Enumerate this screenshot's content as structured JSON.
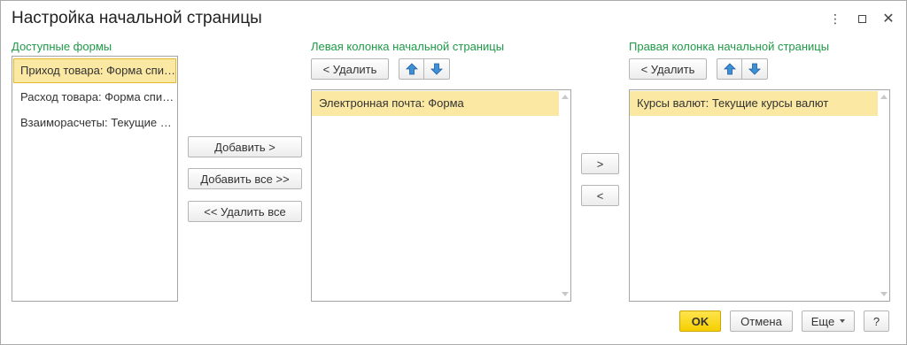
{
  "window": {
    "title": "Настройка начальной страницы",
    "more_glyph": "⋮",
    "close_glyph": "✕"
  },
  "available": {
    "label": "Доступные формы",
    "items": [
      "Приход товара: Форма списка",
      "Расход товара: Форма списка",
      "Взаиморасчеты: Текущие взаиморасчеты"
    ],
    "selected_index": 0
  },
  "middle_buttons": {
    "add": "Добавить >",
    "add_all": "Добавить все >>",
    "remove_all": "<< Удалить все"
  },
  "left_column": {
    "label": "Левая колонка начальной страницы",
    "remove_button": "< Удалить",
    "items": [
      "Электронная почта: Форма"
    ]
  },
  "move_buttons": {
    "to_right": ">",
    "to_left": "<"
  },
  "right_column": {
    "label": "Правая колонка начальной страницы",
    "remove_button": "< Удалить",
    "items": [
      "Курсы валют: Текущие курсы валют"
    ]
  },
  "footer": {
    "ok": "OK",
    "cancel": "Отмена",
    "more": "Еще",
    "help": "?"
  },
  "colors": {
    "label_green": "#1f9a47",
    "selection": "#fbe8a3",
    "ok_yellow": "#f5cf00",
    "arrow_blue": "#3d8fd6"
  },
  "icons": {
    "move_up": "arrow-up-icon",
    "move_down": "arrow-down-icon"
  }
}
